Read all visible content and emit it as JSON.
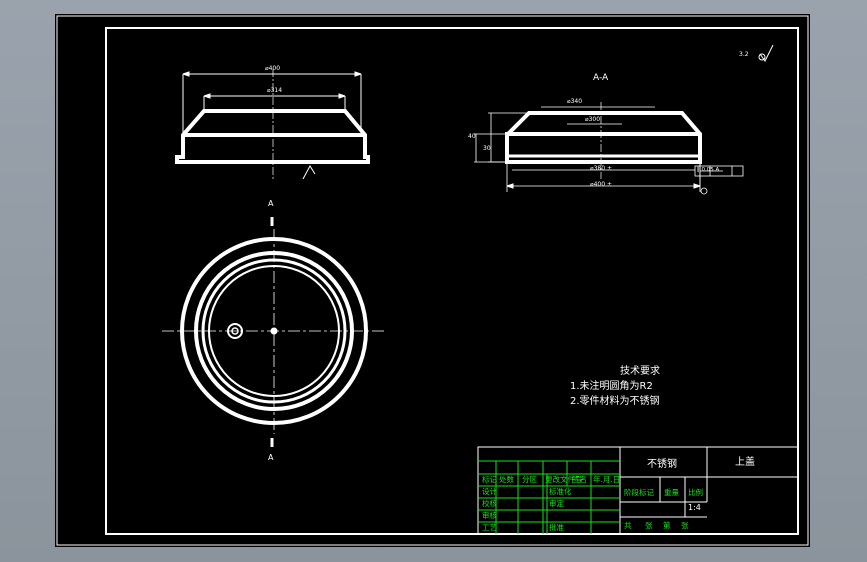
{
  "window": {
    "background": "#929ba4",
    "paper": "#000000"
  },
  "colors": {
    "line": "#ffffff",
    "table": "#19e019",
    "dim": "#ffffff",
    "center": "#ffffff"
  },
  "labels": {
    "section_title": "A-A",
    "section_mark_top": "A",
    "section_mark_bottom": "A",
    "dim_top_outer": "⌀400",
    "dim_top_inner": "⌀314",
    "dim_sec_top": "⌀340",
    "dim_sec_inner": "⌀300",
    "dim_sec_bottom_a": "⌀380 ±",
    "dim_sec_bottom_b": "⌀400 ±",
    "dim_sec_h1": "40",
    "dim_sec_h2": "30",
    "tol_box": "∥ 0.05 A",
    "roughness": "3.2"
  },
  "notes": {
    "title": "技术要求",
    "items": [
      "1.未注明圆角为R2",
      "2.零件材料为不锈钢"
    ]
  },
  "titleblock": {
    "material": "不锈钢",
    "part_name": "上盖",
    "scale": "1:4",
    "row_headers": [
      "标记",
      "处数",
      "分区",
      "更改文件号",
      "签名",
      "年.月.日"
    ],
    "left_rows": [
      "设计",
      "校核",
      "审核",
      "工艺"
    ],
    "mid_labels": [
      "标准化",
      "审定",
      "",
      "批准"
    ],
    "right_headers": [
      "阶段标记",
      "重量",
      "比例"
    ],
    "sheet_info": [
      "共",
      "张",
      "第",
      "张"
    ]
  }
}
